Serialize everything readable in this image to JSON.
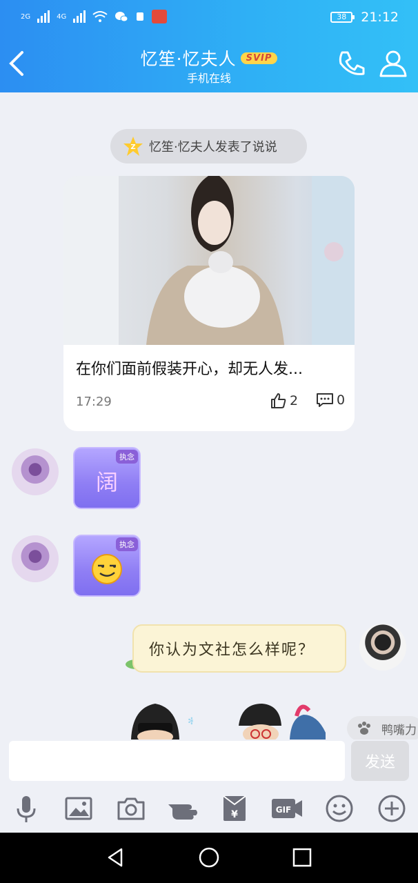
{
  "status_bar": {
    "net1": "2G",
    "net2": "4G",
    "battery": "38",
    "time": "21:12"
  },
  "header": {
    "title": "忆笙·忆夫人",
    "badge": "SVIP",
    "subtitle": "手机在线"
  },
  "notice": {
    "text": "忆笙·忆夫人发表了说说"
  },
  "post_card": {
    "text": "在你们面前假装开心，却无人发...",
    "time": "17:29",
    "likes": "2",
    "comments": "0"
  },
  "messages": [
    {
      "badge": "执念",
      "char": "阔"
    },
    {
      "badge": "执念"
    }
  ],
  "outgoing": {
    "text": "你认为文社怎么样呢？"
  },
  "suggestion": {
    "text": "鸭嘴力"
  },
  "input": {
    "send_label": "发送"
  },
  "icons": {
    "back": "chevron-left-icon",
    "call": "phone-icon",
    "profile": "person-icon",
    "tools": [
      "microphone-icon",
      "image-icon",
      "camera-icon",
      "poke-icon",
      "red-packet-icon",
      "gif-icon",
      "emoji-icon",
      "plus-icon"
    ]
  },
  "colors": {
    "header_start": "#2c8ef2",
    "header_end": "#33c0f7",
    "svip": "#ffd54a",
    "sticker": "#8f7ef4"
  }
}
